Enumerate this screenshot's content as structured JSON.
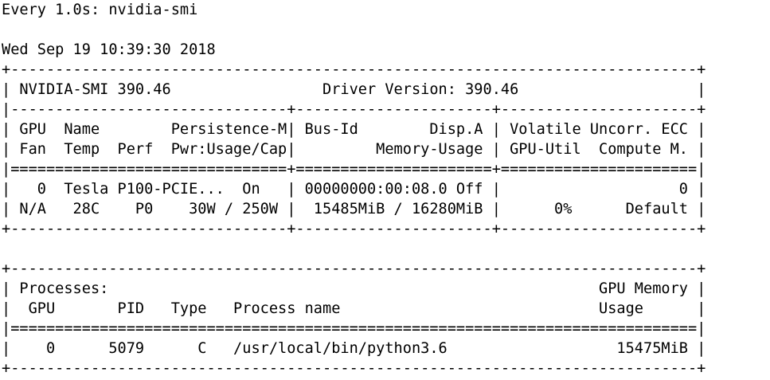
{
  "window": {
    "watch_header": "Every 1.0s: nvidia-smi",
    "timestamp": "Wed Sep 19 10:39:30 2018"
  },
  "smi": {
    "lines": [
      "+-----------------------------------------------------------------------------+",
      "| NVIDIA-SMI 390.46                 Driver Version: 390.46                    |",
      "|-------------------------------+----------------------+----------------------+",
      "| GPU  Name        Persistence-M| Bus-Id        Disp.A | Volatile Uncorr. ECC |",
      "| Fan  Temp  Perf  Pwr:Usage/Cap|         Memory-Usage | GPU-Util  Compute M. |",
      "|===============================+======================+======================|",
      "|   0  Tesla P100-PCIE...  On   | 00000000:00:08.0 Off |                    0 |",
      "| N/A   28C    P0    30W / 250W |  15485MiB / 16280MiB |      0%      Default |",
      "+-------------------------------+----------------------+----------------------+",
      "",
      "+-----------------------------------------------------------------------------+",
      "| Processes:                                                       GPU Memory |",
      "|  GPU       PID   Type   Process name                             Usage      |",
      "|=============================================================================|",
      "|    0      5079      C   /usr/local/bin/python3.6                   15475MiB |",
      "+-----------------------------------------------------------------------------+"
    ]
  }
}
